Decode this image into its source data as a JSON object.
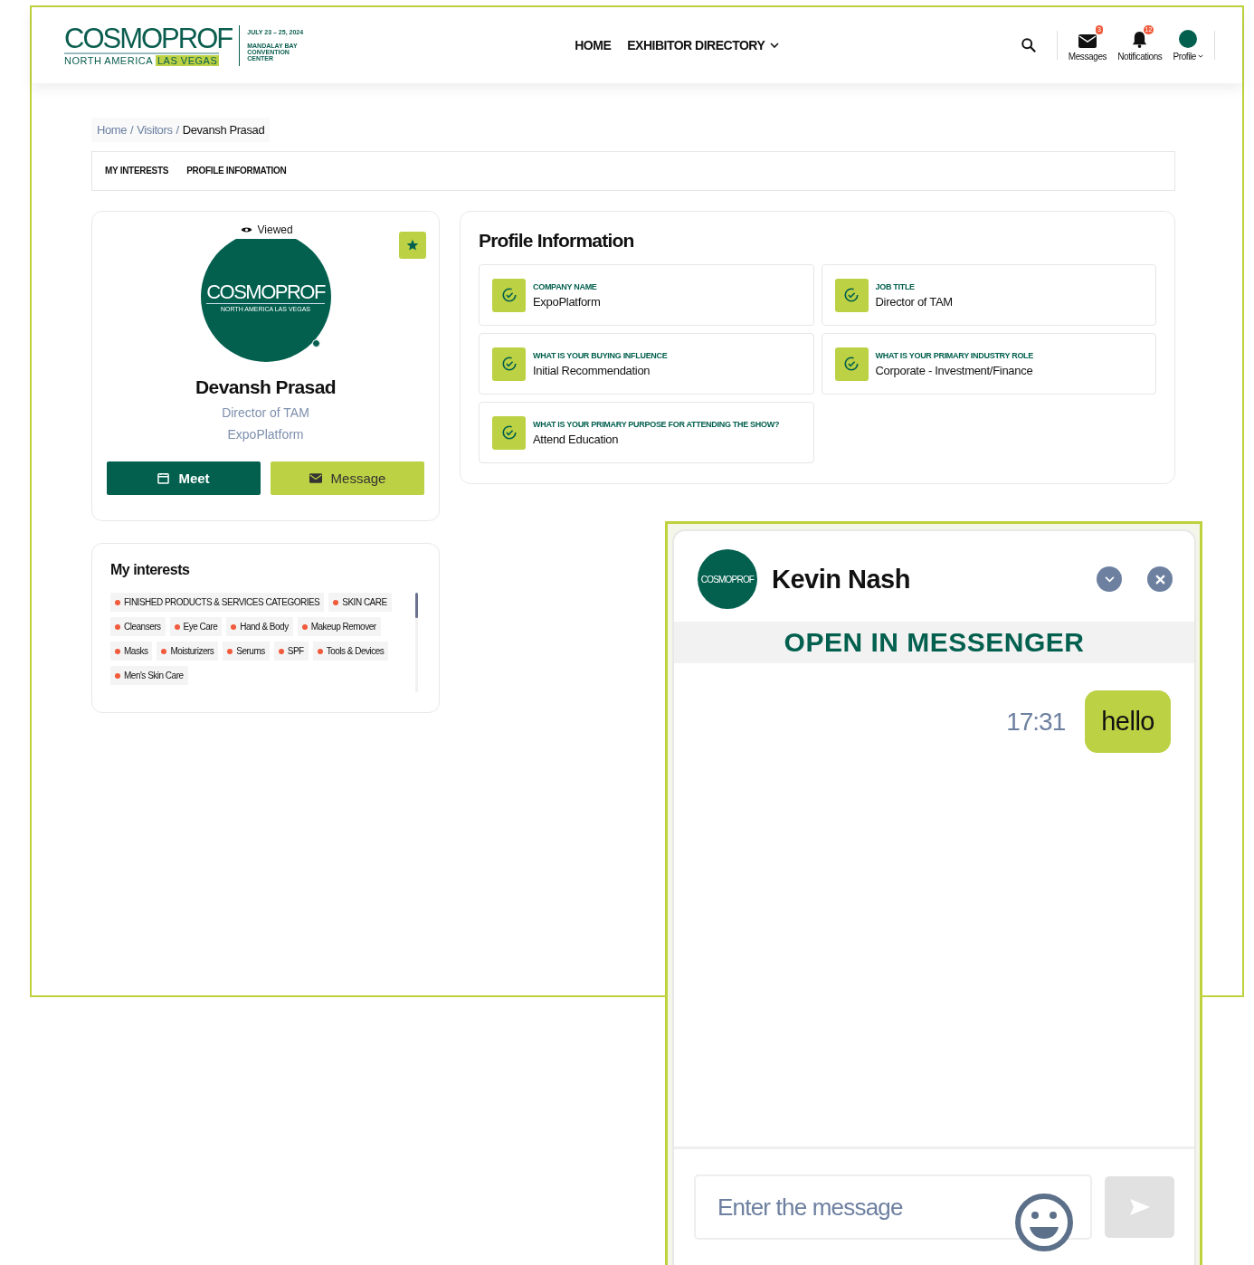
{
  "header": {
    "logo": {
      "wordmark": "COSMOPROF",
      "region": "NORTH AMERICA",
      "city": "LAS VEGAS",
      "dates": "JULY 23 – 25, 2024",
      "venue": "MANDALAY BAY CONVENTION CENTER"
    },
    "nav": [
      {
        "label": "HOME",
        "dropdown": false
      },
      {
        "label": "EXHIBITOR DIRECTORY",
        "dropdown": true
      }
    ],
    "actions": [
      {
        "kind": "messages",
        "label": "Messages",
        "badge": "3"
      },
      {
        "kind": "notifications",
        "label": "Notifications",
        "badge": "12"
      },
      {
        "kind": "profile",
        "label": "Profile"
      }
    ]
  },
  "breadcrumb": {
    "separator": "/",
    "items": [
      "Home",
      "Visitors",
      "Devansh Prasad"
    ]
  },
  "tabs": [
    {
      "label": "MY INTERESTS",
      "selected": false
    },
    {
      "label": "PROFILE INFORMATION",
      "selected": false
    }
  ],
  "profile": {
    "viewed": "Viewed",
    "favorite": true,
    "avatar": {
      "wordmark": "COSMOPROF",
      "sub": "NORTH AMERICA LAS VEGAS"
    },
    "name": "Devansh Prasad",
    "title": "Director of TAM",
    "company": "ExpoPlatform",
    "buttons": [
      {
        "kind": "meet",
        "label": "Meet"
      },
      {
        "kind": "message",
        "label": "Message"
      }
    ]
  },
  "interests": {
    "title": "My interests",
    "tags": [
      "FINISHED PRODUCTS & SERVICES CATEGORIES",
      "SKIN CARE",
      "Cleansers",
      "Eye Care",
      "Hand & Body",
      "Makeup Remover",
      "Masks",
      "Moisturizers",
      "Serums",
      "SPF",
      "Tools & Devices",
      "Men's Skin Care"
    ]
  },
  "profile_information": {
    "title": "Profile Information",
    "fields": [
      {
        "label": "COMPANY NAME",
        "value": "ExpoPlatform"
      },
      {
        "label": "JOB TITLE",
        "value": "Director of TAM"
      },
      {
        "label": "WHAT IS YOUR BUYING INFLUENCE",
        "value": "Initial Recommendation"
      },
      {
        "label": "WHAT IS YOUR PRIMARY INDUSTRY ROLE",
        "value": "Corporate - Investment/Finance"
      },
      {
        "label": "WHAT IS YOUR PRIMARY PURPOSE FOR ATTENDING THE SHOW?",
        "value": "Attend Education"
      }
    ]
  },
  "chat": {
    "avatar": "COSMOPROF",
    "name": "Kevin Nash",
    "open_link": "OPEN IN MESSENGER",
    "messages": [
      {
        "time": "17:31",
        "text": "hello"
      }
    ],
    "input": {
      "placeholder": "Enter the message"
    }
  }
}
